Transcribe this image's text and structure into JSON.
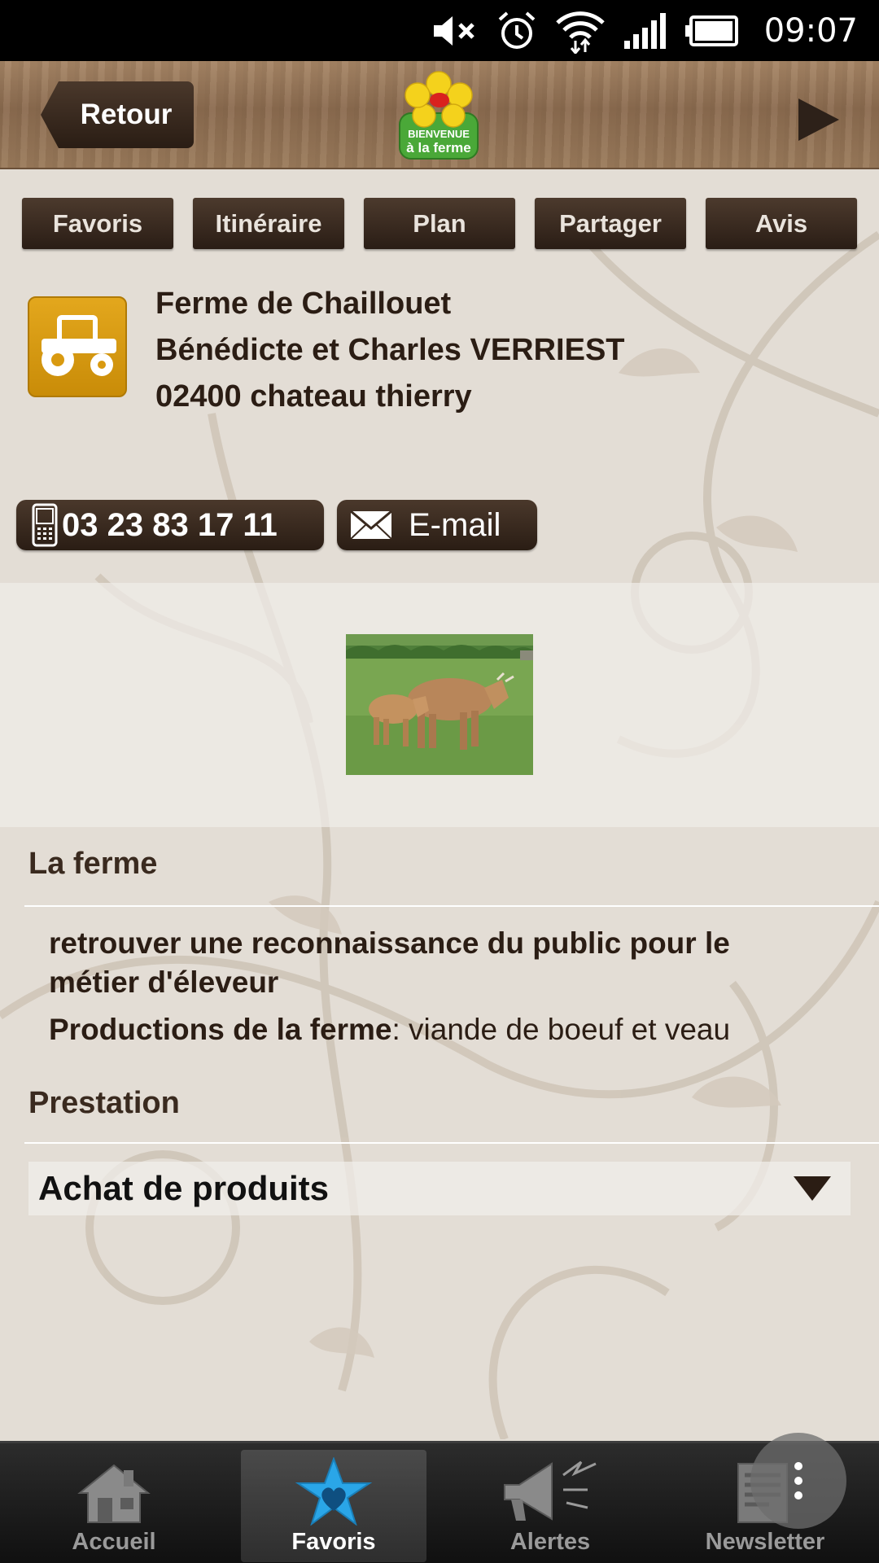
{
  "status_bar": {
    "time": "09:07",
    "icons": [
      "mute-icon",
      "alarm-icon",
      "wifi-icon",
      "signal-icon",
      "battery-icon"
    ]
  },
  "header": {
    "back_label": "Retour",
    "logo_text_line1": "BIENVENUE",
    "logo_text_line2": "à la ferme"
  },
  "action_tabs": [
    "Favoris",
    "Itinéraire",
    "Plan",
    "Partager",
    "Avis"
  ],
  "farm": {
    "name": "Ferme de Chaillouet",
    "owners": "Bénédicte et Charles VERRIEST",
    "address": "02400 chateau thierry",
    "type_icon": "tractor-icon"
  },
  "contact": {
    "phone": "03 23 83 17 11",
    "email_label": "E-mail"
  },
  "sections": {
    "farm_title": "La ferme",
    "description_line1": "retrouver une reconnaissance du public pour le",
    "description_line2": "métier d'éleveur",
    "productions_label": "Productions de la ferme",
    "productions_value": ": viande de boeuf et veau",
    "prestation_title": "Prestation",
    "prestation_dropdown": "Achat de produits"
  },
  "bottom_nav": [
    {
      "label": "Accueil",
      "icon": "house-icon",
      "active": false
    },
    {
      "label": "Favoris",
      "icon": "star-heart-icon",
      "active": true
    },
    {
      "label": "Alertes",
      "icon": "megaphone-icon",
      "active": false
    },
    {
      "label": "Newsletter",
      "icon": "newspaper-icon",
      "active": false
    }
  ],
  "colors": {
    "button_dark": "#2a1d14",
    "farm_icon_bg": "#d99a10",
    "accent_blue": "#2aa6e8"
  }
}
